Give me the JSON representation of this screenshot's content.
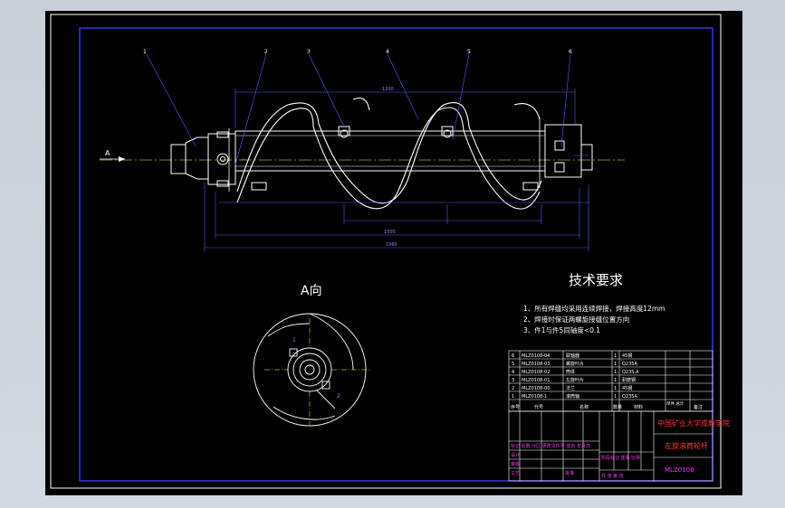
{
  "drawing": {
    "view_label": "A向",
    "arrow_label": "A",
    "part_callouts": [
      "1",
      "2",
      "3",
      "4",
      "5",
      "6"
    ],
    "dimensions": {
      "top_overall": "1200",
      "bottom_overall": "1500",
      "lower_total": "1960"
    },
    "section_labels": [
      "1",
      "2"
    ]
  },
  "tech": {
    "title": "技术要求",
    "items": [
      "1、所有焊缝均采用连续焊接，焊接高度12mm",
      "2、焊接时保证两螺旋接缝位置方向",
      "3、件1与件5同轴度<0.1"
    ]
  },
  "bom": {
    "rows": [
      {
        "no": "6",
        "code": "MLZ0108-04",
        "name": "联轴器",
        "qty": "1",
        "material": "45钢"
      },
      {
        "no": "5",
        "code": "MLZ0108-03",
        "name": "螺旋叶片",
        "qty": "1",
        "material": "Q235A"
      },
      {
        "no": "4",
        "code": "MLZ0108-02",
        "name": "筒体",
        "qty": "1",
        "material": "Q235-A"
      },
      {
        "no": "3",
        "code": "MLZ0108-01",
        "name": "左旋叶片",
        "qty": "1",
        "material": "耐磨钢"
      },
      {
        "no": "2",
        "code": "MLZ0108-00",
        "name": "法兰",
        "qty": "1",
        "material": "45钢"
      },
      {
        "no": "1",
        "code": "MLZ0108-1",
        "name": "滚筒轴",
        "qty": "1",
        "material": "Q235A"
      }
    ],
    "header": {
      "no": "序号",
      "code": "代号",
      "name": "名称",
      "qty": "数量",
      "material": "材料",
      "note": "备注"
    },
    "extra_header": "单件 总计"
  },
  "title_block": {
    "university": "中国矿业大学成教学院",
    "drawing_name": "左旋滚筒轮杆",
    "drawing_no": "MLZ0108",
    "left_labels": [
      "标记 处数 分区 更改文件号 签名 年月日",
      "设计",
      "审核",
      "工艺",
      "批准"
    ],
    "stage_labels": "阶段标记 重量 比例",
    "sheet_info": "共 张 第 张"
  }
}
